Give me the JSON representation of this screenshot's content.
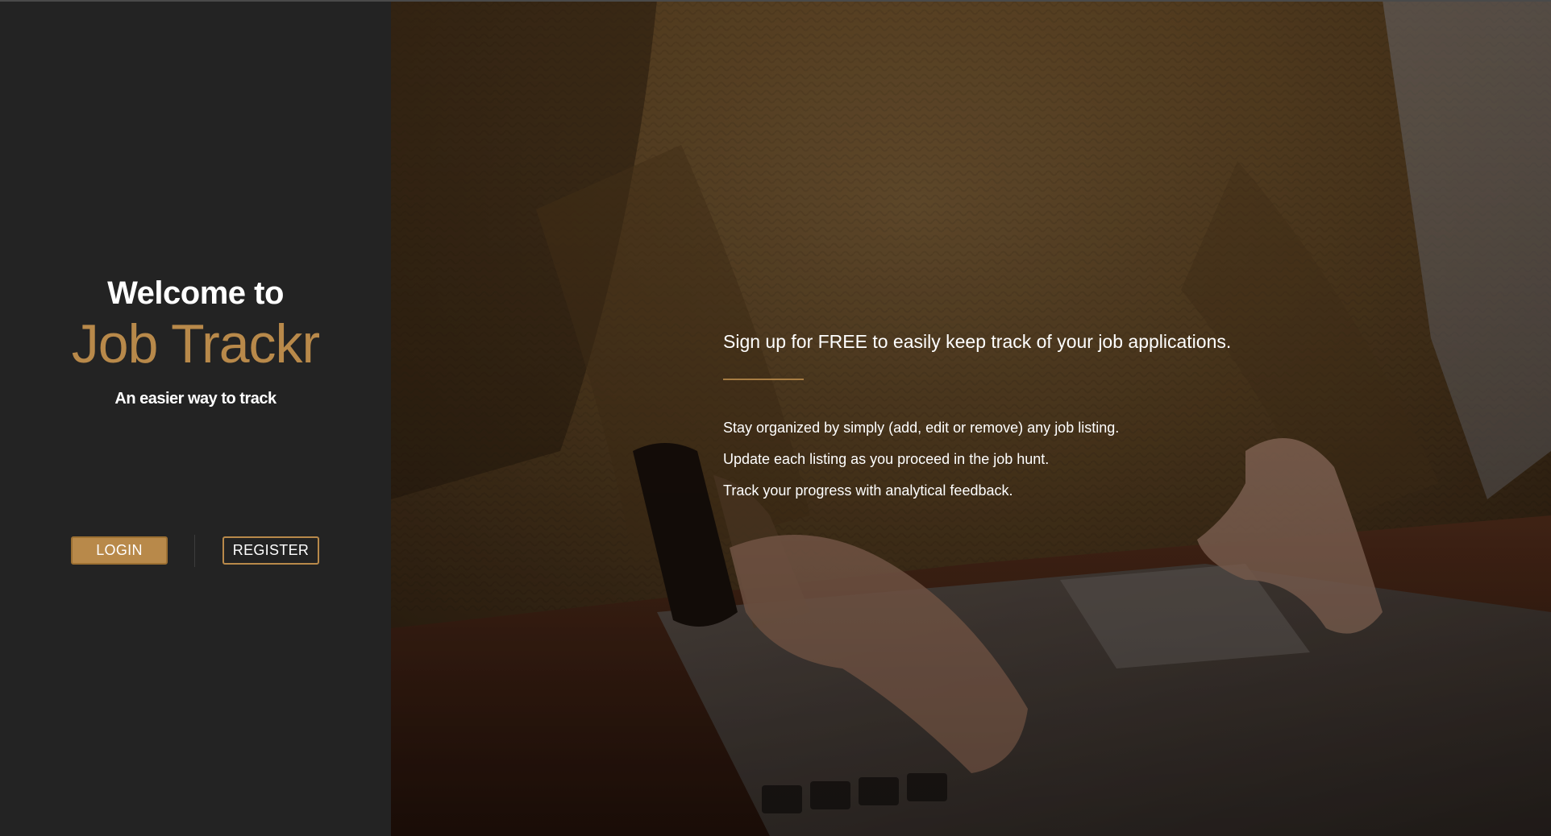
{
  "colors": {
    "accent": "#b8894a",
    "panel_bg": "#232323",
    "text": "#ffffff"
  },
  "sidebar": {
    "welcome": "Welcome to",
    "brand": "Job Trackr",
    "tagline": "An easier way to track",
    "login_label": "LOGIN",
    "register_label": "REGISTER"
  },
  "hero": {
    "headline": "Sign up for FREE to easily keep track of your job applications.",
    "features": [
      "Stay organized by simply (add, edit or remove) any job listing.",
      "Update each listing as you proceed in the job hunt.",
      "Track your progress with analytical feedback."
    ]
  }
}
